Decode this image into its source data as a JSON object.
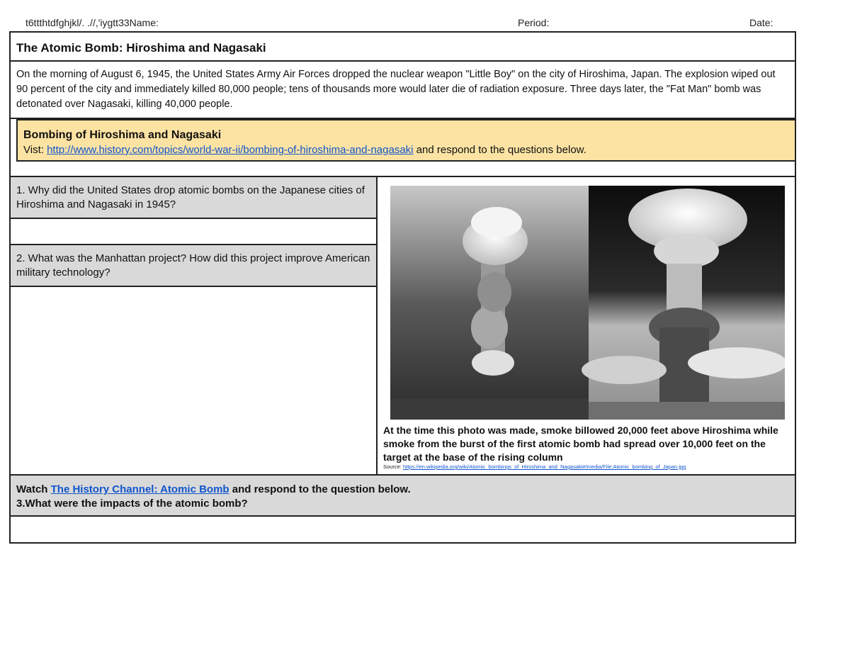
{
  "header": {
    "name_label": "t6ttthtdfghjkl/. .//,'iygtt33Name:",
    "period_label": "Period:",
    "date_label": "Date:"
  },
  "worksheet": {
    "title": "The Atomic Bomb: Hiroshima and Nagasaki",
    "intro": "On the morning of August 6, 1945, the United States Army Air Forces dropped the nuclear weapon \"Little Boy\" on the city of Hiroshima, Japan. The explosion wiped out 90 percent of the city and immediately killed 80,000 people; tens of thousands more would later die of radiation exposure. Three days later, the \"Fat Man\" bomb was detonated over Nagasaki, killing 40,000 people.",
    "activity": {
      "heading": "Bombing of Hiroshima and Nagasaki",
      "visit_prefix": "Vist: ",
      "link": "http://www.history.com/topics/world-war-ii/bombing-of-hiroshima-and-nagasaki",
      "visit_suffix": " and respond to the questions below."
    },
    "questions": [
      {
        "text": "1. Why did the United States drop atomic bombs on the Japanese cities of Hiroshima and Nagasaki in 1945?"
      },
      {
        "text": "2. What was the Manhattan project? How did this project improve American military technology?"
      }
    ],
    "figure": {
      "caption": "At the time this photo was made, smoke billowed 20,000 feet above Hiroshima while smoke from the burst of the first atomic bomb had spread over 10,000 feet on the target at the base of the rising column",
      "source_prefix": "Source: ",
      "source_link": "https://en.wikipedia.org/wiki/Atomic_bombings_of_Hiroshima_and_Nagasaki#/media/File:Atomic_bombing_of_Japan.jpg"
    },
    "video": {
      "prefix": "Watch ",
      "link": "The History Channel: Atomic Bomb",
      "suffix": " and respond to the question below.",
      "question": "3.What were the impacts of the atomic bomb?"
    }
  }
}
